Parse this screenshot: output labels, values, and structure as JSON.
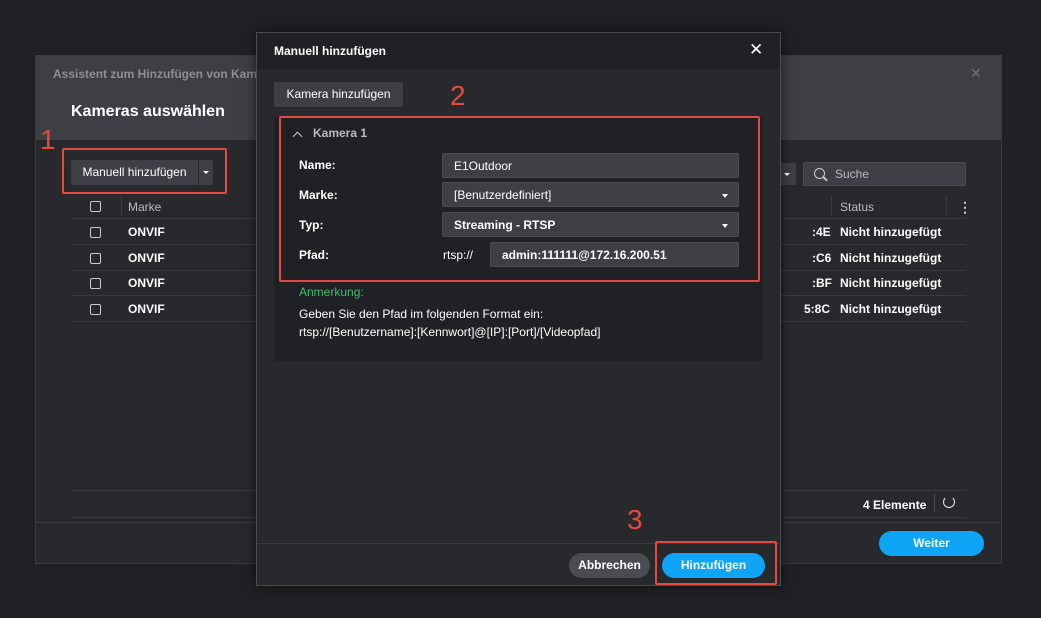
{
  "wizard": {
    "title": "Assistent zum Hinzufügen von Kameras",
    "heading": "Kameras auswählen",
    "manual_button": "Manuell hinzufügen",
    "search_placeholder": "Suche",
    "columns": {
      "brand": "Marke",
      "status": "Status"
    },
    "rows": [
      {
        "brand": "ONVIF",
        "mac_suffix": ":4E",
        "status": "Nicht hinzugefügt"
      },
      {
        "brand": "ONVIF",
        "mac_suffix": ":C6",
        "status": "Nicht hinzugefügt"
      },
      {
        "brand": "ONVIF",
        "mac_suffix": ":BF",
        "status": "Nicht hinzugefügt"
      },
      {
        "brand": "ONVIF",
        "mac_suffix": "5:8C",
        "status": "Nicht hinzugefügt"
      }
    ],
    "count": "4 Elemente",
    "next_button": "Weiter"
  },
  "modal": {
    "title": "Manuell hinzufügen",
    "add_camera_button": "Kamera hinzufügen",
    "camera_title": "Kamera 1",
    "fields": {
      "name_label": "Name:",
      "name_value": "E1Outdoor",
      "brand_label": "Marke:",
      "brand_value": "[Benutzerdefiniert]",
      "type_label": "Typ:",
      "type_value": "Streaming - RTSP",
      "path_label": "Pfad:",
      "path_prefix": "rtsp://",
      "path_value": "admin:111111@172.16.200.51"
    },
    "note_label": "Anmerkung:",
    "note_line1": "Geben Sie den Pfad im folgenden Format ein:",
    "note_line2": "rtsp://[Benutzername]:[Kennwort]@[IP]:[Port]/[Videopfad]",
    "cancel_button": "Abbrechen",
    "add_button": "Hinzufügen"
  },
  "callouts": {
    "one": "1",
    "two": "2",
    "three": "3"
  },
  "colors": {
    "accent": "#0ea5f7",
    "highlight": "#e5483f",
    "note": "#3fbf6f"
  },
  "icons": [
    "close-icon",
    "search-icon",
    "refresh-icon",
    "chevron-up-icon",
    "caret-down-icon",
    "more-vertical-icon"
  ]
}
